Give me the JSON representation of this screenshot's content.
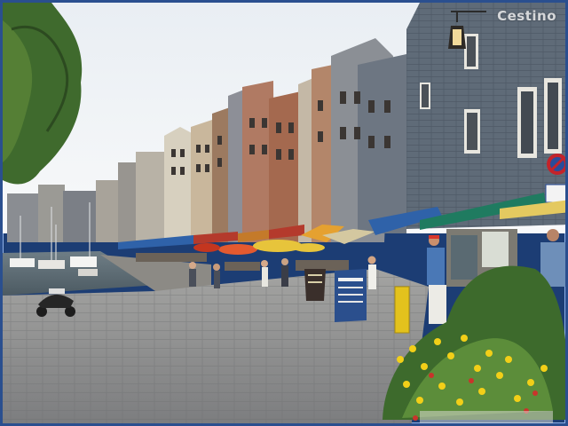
{
  "photo": {
    "subject": "harbour-street",
    "watermark_text": "Cestino"
  },
  "signs": {
    "menu_board": "",
    "sandwich_board": ""
  },
  "colors": {
    "sky": "#f2f4f6",
    "cobblestone": "#8e8f8f",
    "facade_slate": "#5f6b78",
    "awning_green": "#1f7b60",
    "awning_blue": "#2f62a9",
    "awning_red": "#b43a2c",
    "umbrella_yellow": "#e7c43b",
    "flowers_yellow": "#f2cf18",
    "frame_border": "#2a4f8f"
  }
}
